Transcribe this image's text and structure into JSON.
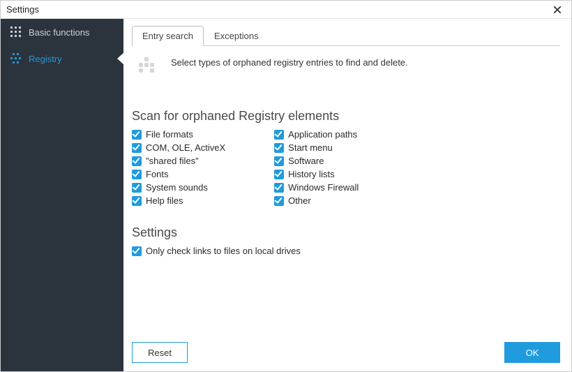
{
  "window": {
    "title": "Settings"
  },
  "sidebar": {
    "items": [
      {
        "label": "Basic functions"
      },
      {
        "label": "Registry"
      }
    ]
  },
  "tabs": [
    {
      "label": "Entry search",
      "active": true
    },
    {
      "label": "Exceptions",
      "active": false
    }
  ],
  "intro": "Select types of orphaned registry entries to find and delete.",
  "scan_section": {
    "heading": "Scan for orphaned Registry elements",
    "left": [
      {
        "label": "File formats",
        "checked": true
      },
      {
        "label": "COM, OLE, ActiveX",
        "checked": true
      },
      {
        "label": "\"shared files\"",
        "checked": true
      },
      {
        "label": "Fonts",
        "checked": true
      },
      {
        "label": "System sounds",
        "checked": true
      },
      {
        "label": "Help files",
        "checked": true
      }
    ],
    "right": [
      {
        "label": "Application paths",
        "checked": true
      },
      {
        "label": "Start menu",
        "checked": true
      },
      {
        "label": "Software",
        "checked": true
      },
      {
        "label": "History lists",
        "checked": true
      },
      {
        "label": "Windows Firewall",
        "checked": true
      },
      {
        "label": "Other",
        "checked": true
      }
    ]
  },
  "settings_section": {
    "heading": "Settings",
    "items": [
      {
        "label": "Only check links to files on local drives",
        "checked": true
      }
    ]
  },
  "buttons": {
    "reset": "Reset",
    "ok": "OK"
  }
}
